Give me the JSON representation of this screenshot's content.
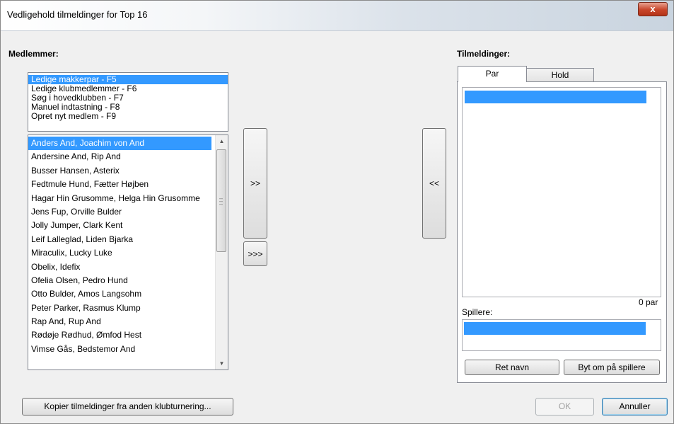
{
  "window": {
    "title": "Vedligehold tilmeldinger for Top 16",
    "close_glyph": "x"
  },
  "left": {
    "label": "Medlemmer:",
    "quick_options": [
      "Ledige makkerpar - F5",
      "Ledige klubmedlemmer - F6",
      "Søg i hovedklubben - F7",
      "Manuel indtastning - F8",
      "Opret nyt medlem - F9"
    ],
    "members": [
      "Anders And, Joachim von And",
      "Andersine And, Rip And",
      "Busser Hansen, Asterix",
      "Fedtmule Hund, Fætter Højben",
      "Hagar Hin Grusomme, Helga Hin Grusomme",
      "Jens Fup, Orville Bulder",
      "Jolly Jumper, Clark Kent",
      "Leif Lalleglad, Liden Bjarka",
      "Miraculix, Lucky Luke",
      "Obelix, Idefix",
      "Ofelia Olsen, Pedro Hund",
      "Otto Bulder, Amos Langsohm",
      "Peter Parker, Rasmus Klump",
      "Rap And, Rup And",
      "Rødøje Rødhud, Ømfod Hest",
      "Vimse Gås, Bedstemor And"
    ]
  },
  "middle": {
    "add_label": ">>",
    "add_all_label": ">>>",
    "remove_label": "<<"
  },
  "right": {
    "label": "Tilmeldinger:",
    "tabs": [
      "Par",
      "Hold"
    ],
    "count_text": "0 par",
    "players_label": "Spillere:",
    "rename_button": "Ret navn",
    "swap_button": "Byt om på spillere"
  },
  "footer": {
    "copy_button": "Kopier tilmeldinger fra anden klubturnering...",
    "ok_button": "OK",
    "cancel_button": "Annuller"
  },
  "colors": {
    "selection": "#3399ff"
  }
}
